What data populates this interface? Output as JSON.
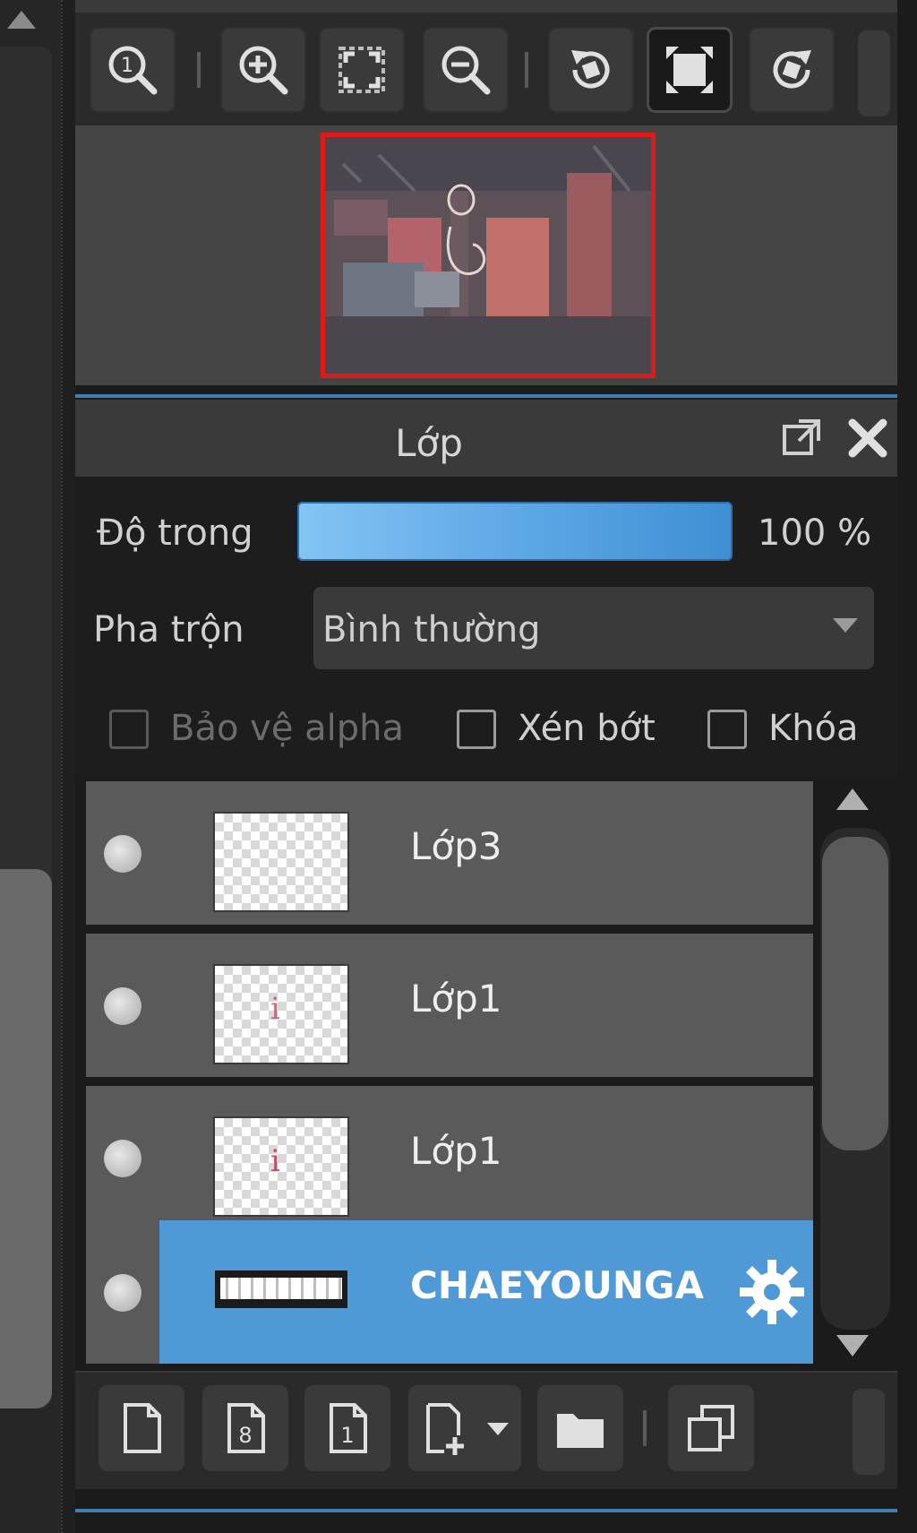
{
  "navigator": {
    "toolbar": [
      {
        "name": "zoom-actual-icon",
        "label": "1"
      },
      {
        "name": "zoom-in-icon"
      },
      {
        "name": "fit-screen-icon"
      },
      {
        "name": "zoom-out-icon"
      },
      {
        "name": "rotate-left-icon"
      },
      {
        "name": "fit-window-icon",
        "active": true
      },
      {
        "name": "rotate-right-icon"
      }
    ],
    "preview_border_color": "#e01818"
  },
  "panel": {
    "title": "Lớp",
    "opacity_label": "Độ trong",
    "opacity_value": "100 %",
    "opacity_fraction": 1.0,
    "blend_label": "Pha trộn",
    "blend_value": "Bình thường",
    "checkboxes": {
      "protect_alpha": "Bảo vệ alpha",
      "clip": "Xén bớt",
      "lock": "Khóa"
    }
  },
  "layers": [
    {
      "name": "Lớp3",
      "thumb": "empty"
    },
    {
      "name": "Lớp1",
      "thumb": "mark"
    },
    {
      "name": "Lớp1",
      "thumb": "mark"
    },
    {
      "name": "CHAEYOUNGA",
      "thumb": "text",
      "selected": true
    }
  ],
  "page_label_1": "1",
  "page_label_8": "8",
  "colors": {
    "accent": "#4f9ad6",
    "panel_bg": "#3a3a3a",
    "row_bg": "#5a5a5a"
  }
}
